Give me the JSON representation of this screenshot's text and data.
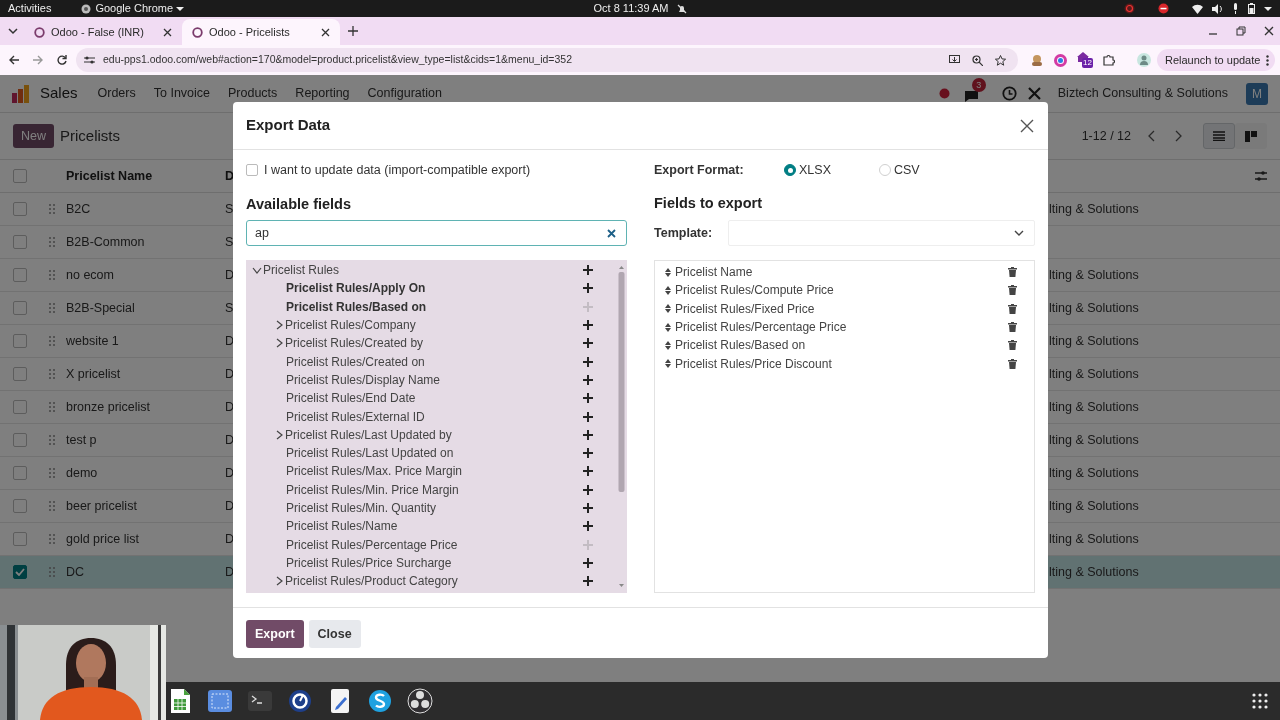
{
  "system_bar": {
    "activities": "Activities",
    "app": "Google Chrome",
    "clock": "Oct 8 11:39 AM"
  },
  "browser": {
    "tabs": [
      {
        "title": "Odoo - False (INR)",
        "selected": false
      },
      {
        "title": "Odoo - Pricelists",
        "selected": true
      }
    ],
    "url": "edu-pps1.odoo.com/web#action=170&model=product.pricelist&view_type=list&cids=1&menu_id=352",
    "extension_badge": "12",
    "relaunch_button": "Relaunch to update"
  },
  "navbar": {
    "app": "Sales",
    "menu": [
      "Orders",
      "To Invoice",
      "Products",
      "Reporting",
      "Configuration"
    ],
    "messages_badge": "3",
    "company": "Biztech Consulting & Solutions",
    "avatar": "M"
  },
  "control_panel": {
    "new_button": "New",
    "title": "Pricelists",
    "pager": "1-12 / 12",
    "views": [
      {
        "kind": "list",
        "selected": true
      },
      {
        "kind": "kanban",
        "selected": false
      }
    ]
  },
  "table": {
    "select_all_checked": false,
    "columns": [
      "Pricelist Name",
      "D"
    ],
    "rows": [
      {
        "name": "B2C",
        "column_2": "S",
        "column_3": "lting & Solutions",
        "selected": false
      },
      {
        "name": "B2B-Common",
        "column_2": "S",
        "selected": false
      },
      {
        "name": "no ecom",
        "column_2": "D",
        "column_3": "lting & Solutions",
        "selected": false
      },
      {
        "name": "B2B-Special",
        "column_2": "S",
        "column_3": "lting & Solutions",
        "selected": false
      },
      {
        "name": "website 1",
        "column_2": "D",
        "column_3": "lting & Solutions",
        "selected": false
      },
      {
        "name": "X pricelist",
        "column_2": "D",
        "column_3": "lting & Solutions",
        "selected": false
      },
      {
        "name": "bronze pricelist",
        "column_2": "D",
        "column_3": "lting & Solutions",
        "selected": false
      },
      {
        "name": "test p",
        "column_2": "D",
        "column_3": "lting & Solutions",
        "selected": false
      },
      {
        "name": "demo",
        "column_2": "D",
        "column_3": "lting & Solutions",
        "selected": false
      },
      {
        "name": "beer pricelist",
        "column_2": "D",
        "column_3": "lting & Solutions",
        "selected": false
      },
      {
        "name": "gold price list",
        "column_2": "D",
        "column_3": "lting & Solutions",
        "selected": false
      },
      {
        "name": "DC",
        "column_2": "D",
        "column_3": "lting & Solutions",
        "selected": true
      }
    ]
  },
  "dialog": {
    "title": "Export Data",
    "import_compatible": {
      "label": "I want to update data (import-compatible export)",
      "checked": false
    },
    "available_heading": "Available fields",
    "search_value": "ap",
    "fields_tree": [
      {
        "label": "Pricelist Rules",
        "kind": "relation",
        "expanded": true,
        "required": false,
        "added": false,
        "children": [
          {
            "label": "Pricelist Rules/Apply On",
            "kind": "field",
            "required": true,
            "added": false
          },
          {
            "label": "Pricelist Rules/Based on",
            "kind": "field",
            "required": true,
            "added": true
          },
          {
            "label": "Pricelist Rules/Company",
            "kind": "relation",
            "expanded": false,
            "required": false,
            "added": false
          },
          {
            "label": "Pricelist Rules/Created by",
            "kind": "relation",
            "expanded": false,
            "required": false,
            "added": false
          },
          {
            "label": "Pricelist Rules/Created on",
            "kind": "field",
            "required": false,
            "added": false
          },
          {
            "label": "Pricelist Rules/Display Name",
            "kind": "field",
            "required": false,
            "added": false
          },
          {
            "label": "Pricelist Rules/End Date",
            "kind": "field",
            "required": false,
            "added": false
          },
          {
            "label": "Pricelist Rules/External ID",
            "kind": "field",
            "required": false,
            "added": false
          },
          {
            "label": "Pricelist Rules/Last Updated by",
            "kind": "relation",
            "expanded": false,
            "required": false,
            "added": false
          },
          {
            "label": "Pricelist Rules/Last Updated on",
            "kind": "field",
            "required": false,
            "added": false
          },
          {
            "label": "Pricelist Rules/Max. Price Margin",
            "kind": "field",
            "required": false,
            "added": false
          },
          {
            "label": "Pricelist Rules/Min. Price Margin",
            "kind": "field",
            "required": false,
            "added": false
          },
          {
            "label": "Pricelist Rules/Min. Quantity",
            "kind": "field",
            "required": false,
            "added": false
          },
          {
            "label": "Pricelist Rules/Name",
            "kind": "field",
            "required": false,
            "added": false
          },
          {
            "label": "Pricelist Rules/Percentage Price",
            "kind": "field",
            "required": false,
            "added": true
          },
          {
            "label": "Pricelist Rules/Price Surcharge",
            "kind": "field",
            "required": false,
            "added": false
          },
          {
            "label": "Pricelist Rules/Product Category",
            "kind": "relation",
            "expanded": false,
            "required": false,
            "added": false
          }
        ]
      }
    ],
    "format_label": "Export Format:",
    "formats": [
      {
        "label": "XLSX",
        "selected": true
      },
      {
        "label": "CSV",
        "selected": false
      }
    ],
    "export_heading": "Fields to export",
    "template_label": "Template:",
    "export_fields": [
      "Pricelist Name",
      "Pricelist Rules/Compute Price",
      "Pricelist Rules/Fixed Price",
      "Pricelist Rules/Percentage Price",
      "Pricelist Rules/Based on",
      "Pricelist Rules/Price Discount"
    ],
    "buttons": [
      {
        "label": "Export",
        "kind": "primary"
      },
      {
        "label": "Close",
        "kind": "secondary"
      }
    ]
  }
}
